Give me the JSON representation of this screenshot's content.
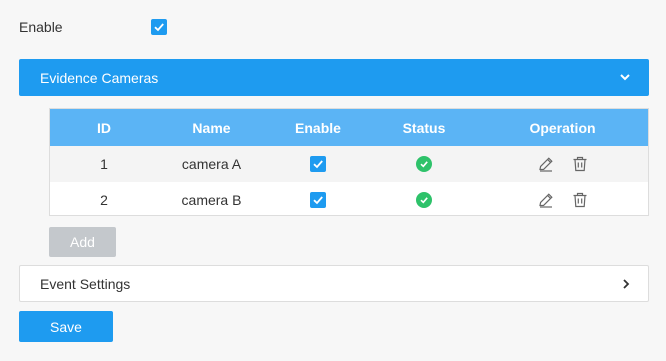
{
  "enable": {
    "label": "Enable",
    "checked": true
  },
  "evidence_cameras": {
    "title": "Evidence Cameras",
    "expanded": true,
    "icon": "chevron-down-icon"
  },
  "table": {
    "headers": {
      "id": "ID",
      "name": "Name",
      "enable": "Enable",
      "status": "Status",
      "operation": "Operation"
    },
    "rows": [
      {
        "id": "1",
        "name": "camera A",
        "enabled": true,
        "status": "online"
      },
      {
        "id": "2",
        "name": "camera B",
        "enabled": true,
        "status": "online"
      }
    ]
  },
  "buttons": {
    "add": "Add",
    "save": "Save"
  },
  "event_settings": {
    "title": "Event Settings",
    "expanded": false,
    "icon": "chevron-right-icon"
  },
  "colors": {
    "accent": "#1e9bf0",
    "header": "#5bb4f5",
    "status_ok": "#2ec26a",
    "disabled_btn": "#c4c8cc"
  }
}
